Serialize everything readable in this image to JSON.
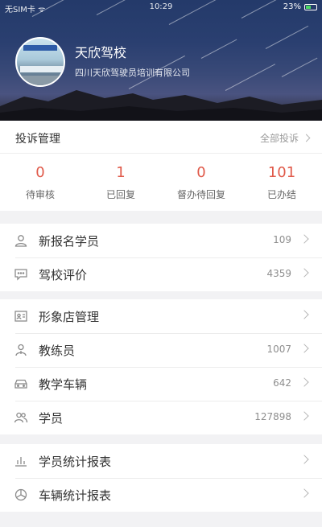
{
  "status_bar": {
    "carrier": "无SIM卡 ᯤ",
    "time": "10:29",
    "battery": "23%"
  },
  "header": {
    "school_name": "天欣驾校",
    "company_name": "四川天欣驾驶员培训有限公司"
  },
  "complaints": {
    "title": "投诉管理",
    "all_label": "全部投诉",
    "stats": [
      {
        "value": "0",
        "label": "待审核"
      },
      {
        "value": "1",
        "label": "已回复"
      },
      {
        "value": "0",
        "label": "督办待回复"
      },
      {
        "value": "101",
        "label": "已办结"
      }
    ]
  },
  "group1": [
    {
      "label": "新报名学员",
      "count": "109",
      "icon": "new-student-icon"
    },
    {
      "label": "驾校评价",
      "count": "4359",
      "icon": "comment-icon"
    }
  ],
  "group2": [
    {
      "label": "形象店管理",
      "count": "",
      "icon": "store-card-icon"
    },
    {
      "label": "教练员",
      "count": "1007",
      "icon": "coach-icon"
    },
    {
      "label": "教学车辆",
      "count": "642",
      "icon": "car-icon"
    },
    {
      "label": "学员",
      "count": "127898",
      "icon": "students-icon"
    }
  ],
  "group3": [
    {
      "label": "学员统计报表",
      "count": "",
      "icon": "bar-chart-icon"
    },
    {
      "label": "车辆统计报表",
      "count": "",
      "icon": "pie-chart-icon"
    }
  ],
  "colors": {
    "accent_red": "#e05a4a",
    "header_blue": "#2a3f70"
  }
}
